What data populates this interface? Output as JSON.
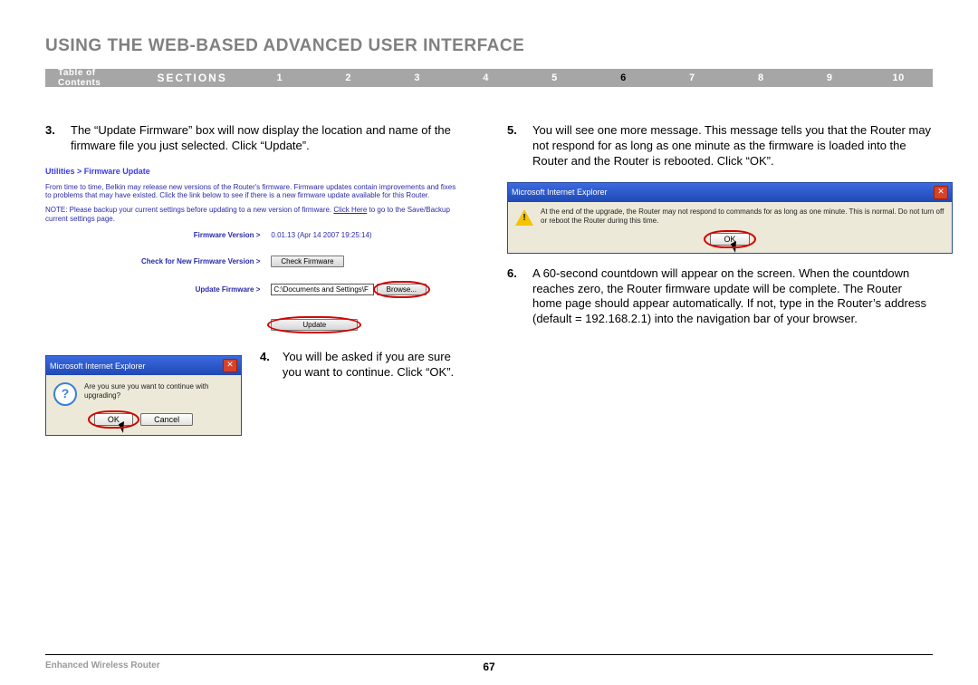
{
  "header": {
    "title": "USING THE WEB-BASED ADVANCED USER INTERFACE"
  },
  "navbar": {
    "toc": "Table of Contents",
    "sections": "SECTIONS",
    "items": [
      "1",
      "2",
      "3",
      "4",
      "5",
      "6",
      "7",
      "8",
      "9",
      "10"
    ],
    "active_index": 5
  },
  "steps": {
    "s3": {
      "num": "3.",
      "text": "The “Update Firmware” box will now display the location and name of the firmware file you just selected. Click “Update”."
    },
    "s4": {
      "num": "4.",
      "text": "You will be asked if you are sure you want to continue. Click “OK”."
    },
    "s5": {
      "num": "5.",
      "text": "You will see one more message. This message tells you that the Router may not respond for as long as one minute as the firmware is loaded into the Router and the Router is rebooted. Click “OK”."
    },
    "s6": {
      "num": "6.",
      "text": "A 60-second countdown will appear on the screen. When the countdown reaches zero, the Router firmware update will be complete. The Router home page should appear automatically. If not, type in the Router’s address (default = 192.168.2.1) into the navigation bar of your browser."
    }
  },
  "shotA": {
    "breadcrumb": "Utilities > Firmware Update",
    "para1": "From time to time, Belkin may release new versions of the Router's firmware. Firmware updates contain improvements and fixes to problems that may have existed. Click the link below to see if there is a new firmware update available for this Router.",
    "para2a": "NOTE: Please backup your current settings before updating to a new version of firmware. ",
    "para2link": "Click Here",
    "para2b": " to go to the Save/Backup current settings page.",
    "rows": {
      "fw_label": "Firmware Version >",
      "fw_value": "0.01.13 (Apr 14 2007 19:25:14)",
      "check_label": "Check for New Firmware Version >",
      "check_btn": "Check Firmware",
      "update_label": "Update Firmware >",
      "path_value": "C:\\Documents and Settings\\F",
      "browse_btn": "Browse...",
      "update_btn": "Update"
    }
  },
  "dlgB": {
    "title": "Microsoft Internet Explorer",
    "msg": "Are you sure you want to continue with upgrading?",
    "ok": "OK",
    "cancel": "Cancel"
  },
  "dlgC": {
    "title": "Microsoft Internet Explorer",
    "msg": "At the end of the upgrade, the Router may not respond to commands for as long as one minute. This is normal. Do not turn off or reboot the Router during this time.",
    "ok": "OK"
  },
  "footer": {
    "product": "Enhanced Wireless Router",
    "page": "67"
  }
}
